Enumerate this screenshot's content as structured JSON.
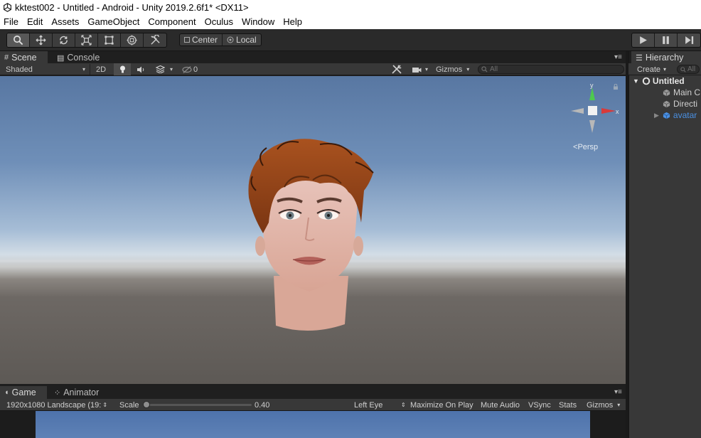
{
  "window": {
    "title": "kktest002 - Untitled - Android - Unity 2019.2.6f1* <DX11>"
  },
  "menu": [
    "File",
    "Edit",
    "Assets",
    "GameObject",
    "Component",
    "Oculus",
    "Window",
    "Help"
  ],
  "toolbar": {
    "tools": [
      "hand-tool",
      "move-tool",
      "rotate-tool",
      "scale-tool",
      "rect-tool",
      "transform-tool",
      "custom-tool"
    ],
    "active_tool": "hand-tool",
    "pivot": "Center",
    "space": "Local"
  },
  "scene_tabs": {
    "scene": "Scene",
    "console": "Console"
  },
  "scene_toolbar": {
    "shading": "Shaded",
    "mode_2d": "2D",
    "hidden_count": "0",
    "gizmos": "Gizmos",
    "search_placeholder": "All"
  },
  "gizmo": {
    "projection": "Persp",
    "y": "y",
    "x": "x"
  },
  "hierarchy": {
    "title": "Hierarchy",
    "create": "Create",
    "search_placeholder": "All",
    "scene": "Untitled",
    "items": [
      "Main C",
      "Directi",
      "avatar"
    ]
  },
  "game_tabs": {
    "game": "Game",
    "animator": "Animator"
  },
  "game_toolbar": {
    "resolution": "1920x1080 Landscape (19:",
    "scale_label": "Scale",
    "scale_value": "0.40",
    "eye": "Left Eye",
    "maximize": "Maximize On Play",
    "mute": "Mute Audio",
    "vsync": "VSync",
    "stats": "Stats",
    "gizmos": "Gizmos"
  },
  "colors": {
    "background": "#383838",
    "selected_text": "#4a90e2",
    "gizmo_y": "#4ec94e",
    "gizmo_x": "#d83a3a"
  }
}
